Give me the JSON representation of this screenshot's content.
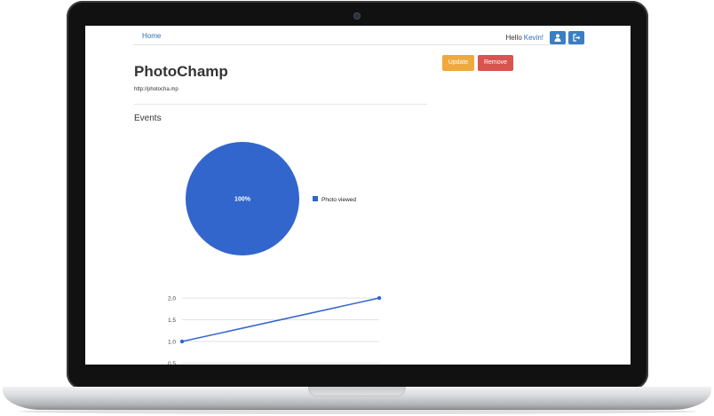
{
  "navbar": {
    "home_label": "Home",
    "greeting": "Hello",
    "user_name": "Kevin!",
    "profile_icon": "user-icon",
    "logout_icon": "logout-icon"
  },
  "app": {
    "title": "PhotoChamp",
    "url": "http://photocha.mp"
  },
  "actions": {
    "update_label": "Update",
    "remove_label": "Remove"
  },
  "events": {
    "heading": "Events"
  },
  "colors": {
    "series_blue": "#3366cc",
    "update": "#efa93c",
    "remove": "#d9534f",
    "link": "#2a6db5"
  },
  "chart_data": [
    {
      "type": "pie",
      "slices": [
        {
          "label": "Photo viewed",
          "value": 100,
          "display": "100%"
        }
      ],
      "legend": "right"
    },
    {
      "type": "line",
      "series": [
        {
          "values": [
            1.0,
            2.0
          ]
        }
      ],
      "x": [
        0,
        1
      ],
      "ylim": [
        0.5,
        2.0
      ],
      "yticks": [
        "2.0",
        "1.5",
        "1.0",
        "0.5"
      ],
      "grid": true
    }
  ]
}
